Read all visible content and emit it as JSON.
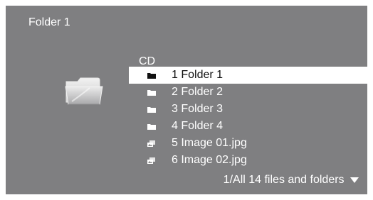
{
  "header": {
    "title": "Folder 1"
  },
  "browser": {
    "location": "CD",
    "items": [
      {
        "number": "1",
        "label": "1 Folder 1",
        "type": "folder",
        "selected": true
      },
      {
        "number": "2",
        "label": "2 Folder 2",
        "type": "folder",
        "selected": false
      },
      {
        "number": "3",
        "label": "3 Folder 3",
        "type": "folder",
        "selected": false
      },
      {
        "number": "4",
        "label": "4 Folder 4",
        "type": "folder",
        "selected": false
      },
      {
        "number": "5",
        "label": "5 Image 01.jpg",
        "type": "image",
        "selected": false
      },
      {
        "number": "6",
        "label": "6 Image 02.jpg",
        "type": "image",
        "selected": false
      }
    ]
  },
  "footer": {
    "status": "1/All 14 files and folders"
  },
  "icons": {
    "large": "open-folder-icon",
    "folder": "folder-icon",
    "image": "image-file-icon",
    "more": "chevron-down-icon"
  },
  "colors": {
    "background": "#7f7f81",
    "text": "#ffffff",
    "selection_bg": "#ffffff",
    "selection_text": "#111111"
  }
}
